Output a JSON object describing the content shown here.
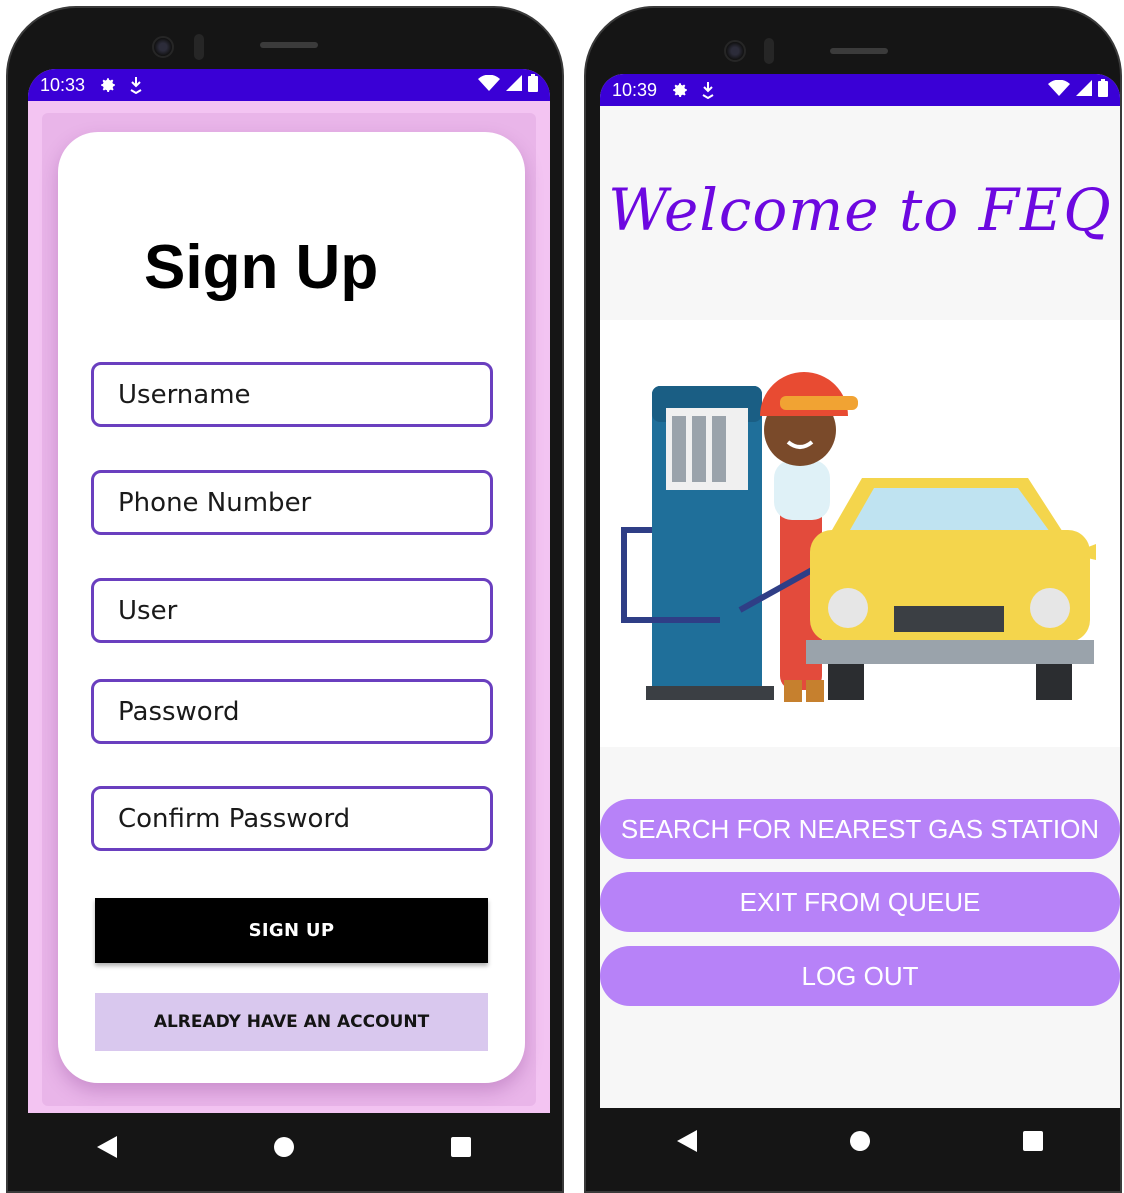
{
  "left": {
    "status": {
      "time": "10:33"
    },
    "title": "Sign Up",
    "fields": [
      {
        "placeholder": "Username"
      },
      {
        "placeholder": "Phone Number"
      },
      {
        "placeholder": "User"
      },
      {
        "placeholder": "Password"
      },
      {
        "placeholder": "Confirm Password"
      }
    ],
    "signup_label": "SIGN UP",
    "already_label": "ALREADY HAVE AN ACCOUNT"
  },
  "right": {
    "status": {
      "time": "10:39"
    },
    "welcome": "Welcome to FEQ",
    "buttons": {
      "search": "SEARCH FOR NEAREST GAS STATION",
      "exit": "EXIT FROM QUEUE",
      "logout": "LOG OUT"
    }
  },
  "colors": {
    "status_bar": "#3a00d6",
    "signup_background": "#f3c4f2",
    "field_border": "#6a3fbf",
    "welcome_text": "#6d08e0",
    "pill_button": "#b782f8"
  },
  "icons": {
    "status": [
      "settings-icon",
      "download-icon",
      "wifi-icon",
      "signal-icon",
      "battery-icon"
    ],
    "nav": [
      "back-icon",
      "home-icon",
      "recents-icon"
    ]
  }
}
